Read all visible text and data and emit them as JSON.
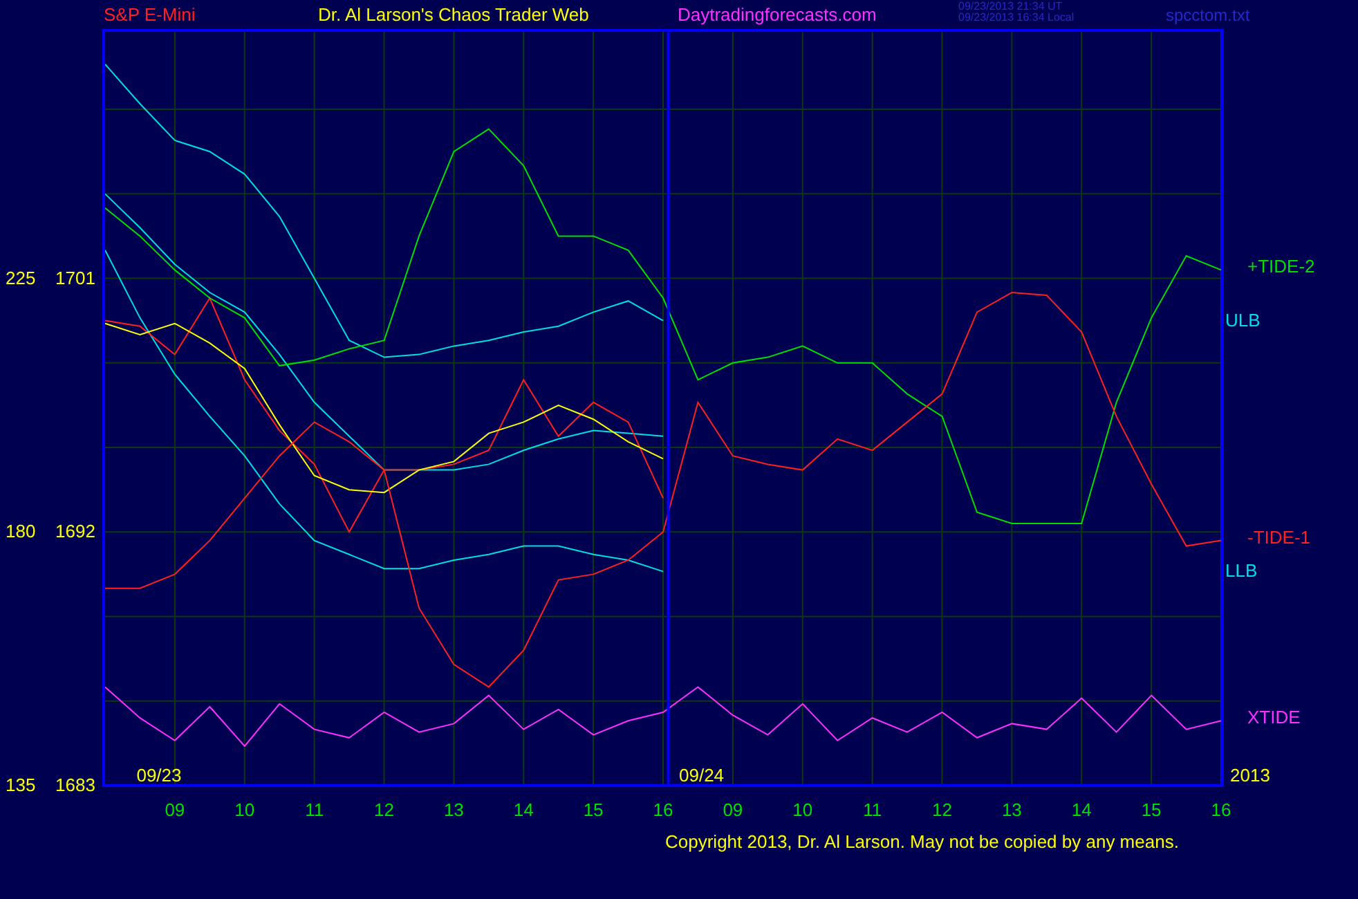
{
  "header": {
    "symbol": "S&P E-Mini",
    "title": "Dr. Al Larson's Chaos Trader Web",
    "site": "Daytradingforecasts.com",
    "timestamps": [
      "09/23/2013 21:34 UT",
      "09/23/2013 16:34 Local"
    ],
    "file": "spcctom.txt"
  },
  "chart": {
    "secondary_tick_labels": [
      "225",
      "180",
      "135"
    ],
    "chart_data": {
      "type": "line",
      "grid": true,
      "ylim": [
        1683,
        1709.8
      ],
      "categories": [
        null,
        null,
        "09",
        null,
        "10",
        null,
        "11",
        null,
        "12",
        null,
        "13",
        null,
        "14",
        null,
        "15",
        null,
        "16",
        null,
        "09",
        null,
        "10",
        null,
        "11",
        null,
        "12",
        null,
        "13",
        null,
        "14",
        null,
        "15",
        null,
        "16"
      ],
      "yticks": [
        1683,
        1692,
        1701
      ],
      "series": [
        {
          "name": "ULB",
          "color": "#00e0e0",
          "values": [
            1708.6,
            1707.2,
            1705.9,
            1705.5,
            1704.7,
            1703.2,
            1701.0,
            1698.8,
            1698.2,
            1698.3,
            1698.6,
            1698.8,
            1699.1,
            1699.3,
            1699.8,
            1700.2,
            1699.5,
            null,
            null,
            null,
            null,
            null,
            null,
            null,
            null,
            null,
            null,
            null,
            null,
            null,
            null,
            null,
            null
          ]
        },
        {
          "color": "#00e0e0",
          "values": [
            1704.0,
            1702.8,
            1701.5,
            1700.5,
            1699.8,
            1698.3,
            1696.6,
            1695.4,
            1694.2,
            1694.2,
            1694.2,
            1694.4,
            1694.9,
            1695.3,
            1695.6,
            1695.5,
            1695.4,
            null,
            null,
            null,
            null,
            null,
            null,
            null,
            null,
            null,
            null,
            null,
            null,
            null,
            null,
            null,
            null
          ]
        },
        {
          "name": "LLB",
          "color": "#00e0e0",
          "values": [
            1702.0,
            1699.6,
            1697.6,
            1696.1,
            1694.7,
            1693.0,
            1691.7,
            1691.2,
            1690.7,
            1690.7,
            1691.0,
            1691.2,
            1691.5,
            1691.5,
            1691.2,
            1691.0,
            1690.6,
            null,
            null,
            null,
            null,
            null,
            null,
            null,
            null,
            null,
            null,
            null,
            null,
            null,
            null,
            null,
            null
          ]
        },
        {
          "color": "#ff2020",
          "values": [
            1699.5,
            1699.3,
            1698.3,
            1700.3,
            1697.4,
            1695.6,
            1694.4,
            1692.0,
            1694.2,
            1694.2,
            1694.4,
            1694.9,
            1697.4,
            1695.4,
            1696.6,
            1695.9,
            1693.2,
            null,
            null,
            null,
            null,
            null,
            null,
            null,
            null,
            null,
            null,
            null,
            null,
            null,
            null,
            null,
            null
          ]
        },
        {
          "color": "#ffff00",
          "values": [
            1699.4,
            1699.0,
            1699.4,
            1698.7,
            1697.8,
            1695.8,
            1694.0,
            1693.5,
            1693.4,
            1694.2,
            1694.5,
            1695.5,
            1695.9,
            1696.5,
            1696.0,
            1695.2,
            1694.6,
            null,
            null,
            null,
            null,
            null,
            null,
            null,
            null,
            null,
            null,
            null,
            null,
            null,
            null,
            null,
            null
          ]
        },
        {
          "name": "+TIDE-2",
          "color": "#00e000",
          "values": [
            1703.5,
            1702.5,
            1701.3,
            1700.3,
            1699.6,
            1697.9,
            1698.1,
            1698.5,
            1698.8,
            1702.5,
            1705.5,
            1706.3,
            1705.0,
            1702.5,
            1702.5,
            1702.0,
            1700.3,
            1697.4,
            1698.0,
            1698.2,
            1698.6,
            1698.0,
            1698.0,
            1696.9,
            1696.1,
            1692.7,
            1692.3,
            1692.3,
            1692.3,
            1696.6,
            1699.6,
            1701.8,
            1701.3
          ]
        },
        {
          "name": "-TIDE-1",
          "color": "#ff2020",
          "values": [
            1690.0,
            1690.0,
            1690.5,
            1691.7,
            1693.2,
            1694.7,
            1695.9,
            1695.2,
            1694.2,
            1689.3,
            1687.3,
            1686.5,
            1687.8,
            1690.3,
            1690.5,
            1691.0,
            1692.0,
            1696.6,
            1694.7,
            1694.4,
            1694.2,
            1695.3,
            1694.9,
            1695.9,
            1696.9,
            1699.8,
            1700.5,
            1700.4,
            1699.1,
            1696.1,
            1693.7,
            1691.5,
            1691.7
          ]
        },
        {
          "name": "XTIDE",
          "color": "#ff30ff",
          "values": [
            1686.5,
            1685.4,
            1684.6,
            1685.8,
            1684.4,
            1685.9,
            1685.0,
            1684.7,
            1685.6,
            1684.9,
            1685.2,
            1686.2,
            1685.0,
            1685.7,
            1684.8,
            1685.3,
            1685.6,
            1686.5,
            1685.5,
            1684.8,
            1685.9,
            1684.6,
            1685.4,
            1684.9,
            1685.6,
            1684.7,
            1685.2,
            1685.0,
            1686.1,
            1684.9,
            1686.2,
            1685.0,
            1685.3
          ]
        }
      ],
      "annotations": [
        "09/23",
        "09/24",
        "2013"
      ]
    }
  },
  "copyright": "Copyright 2013, Dr. Al Larson. May not be copied by any means."
}
